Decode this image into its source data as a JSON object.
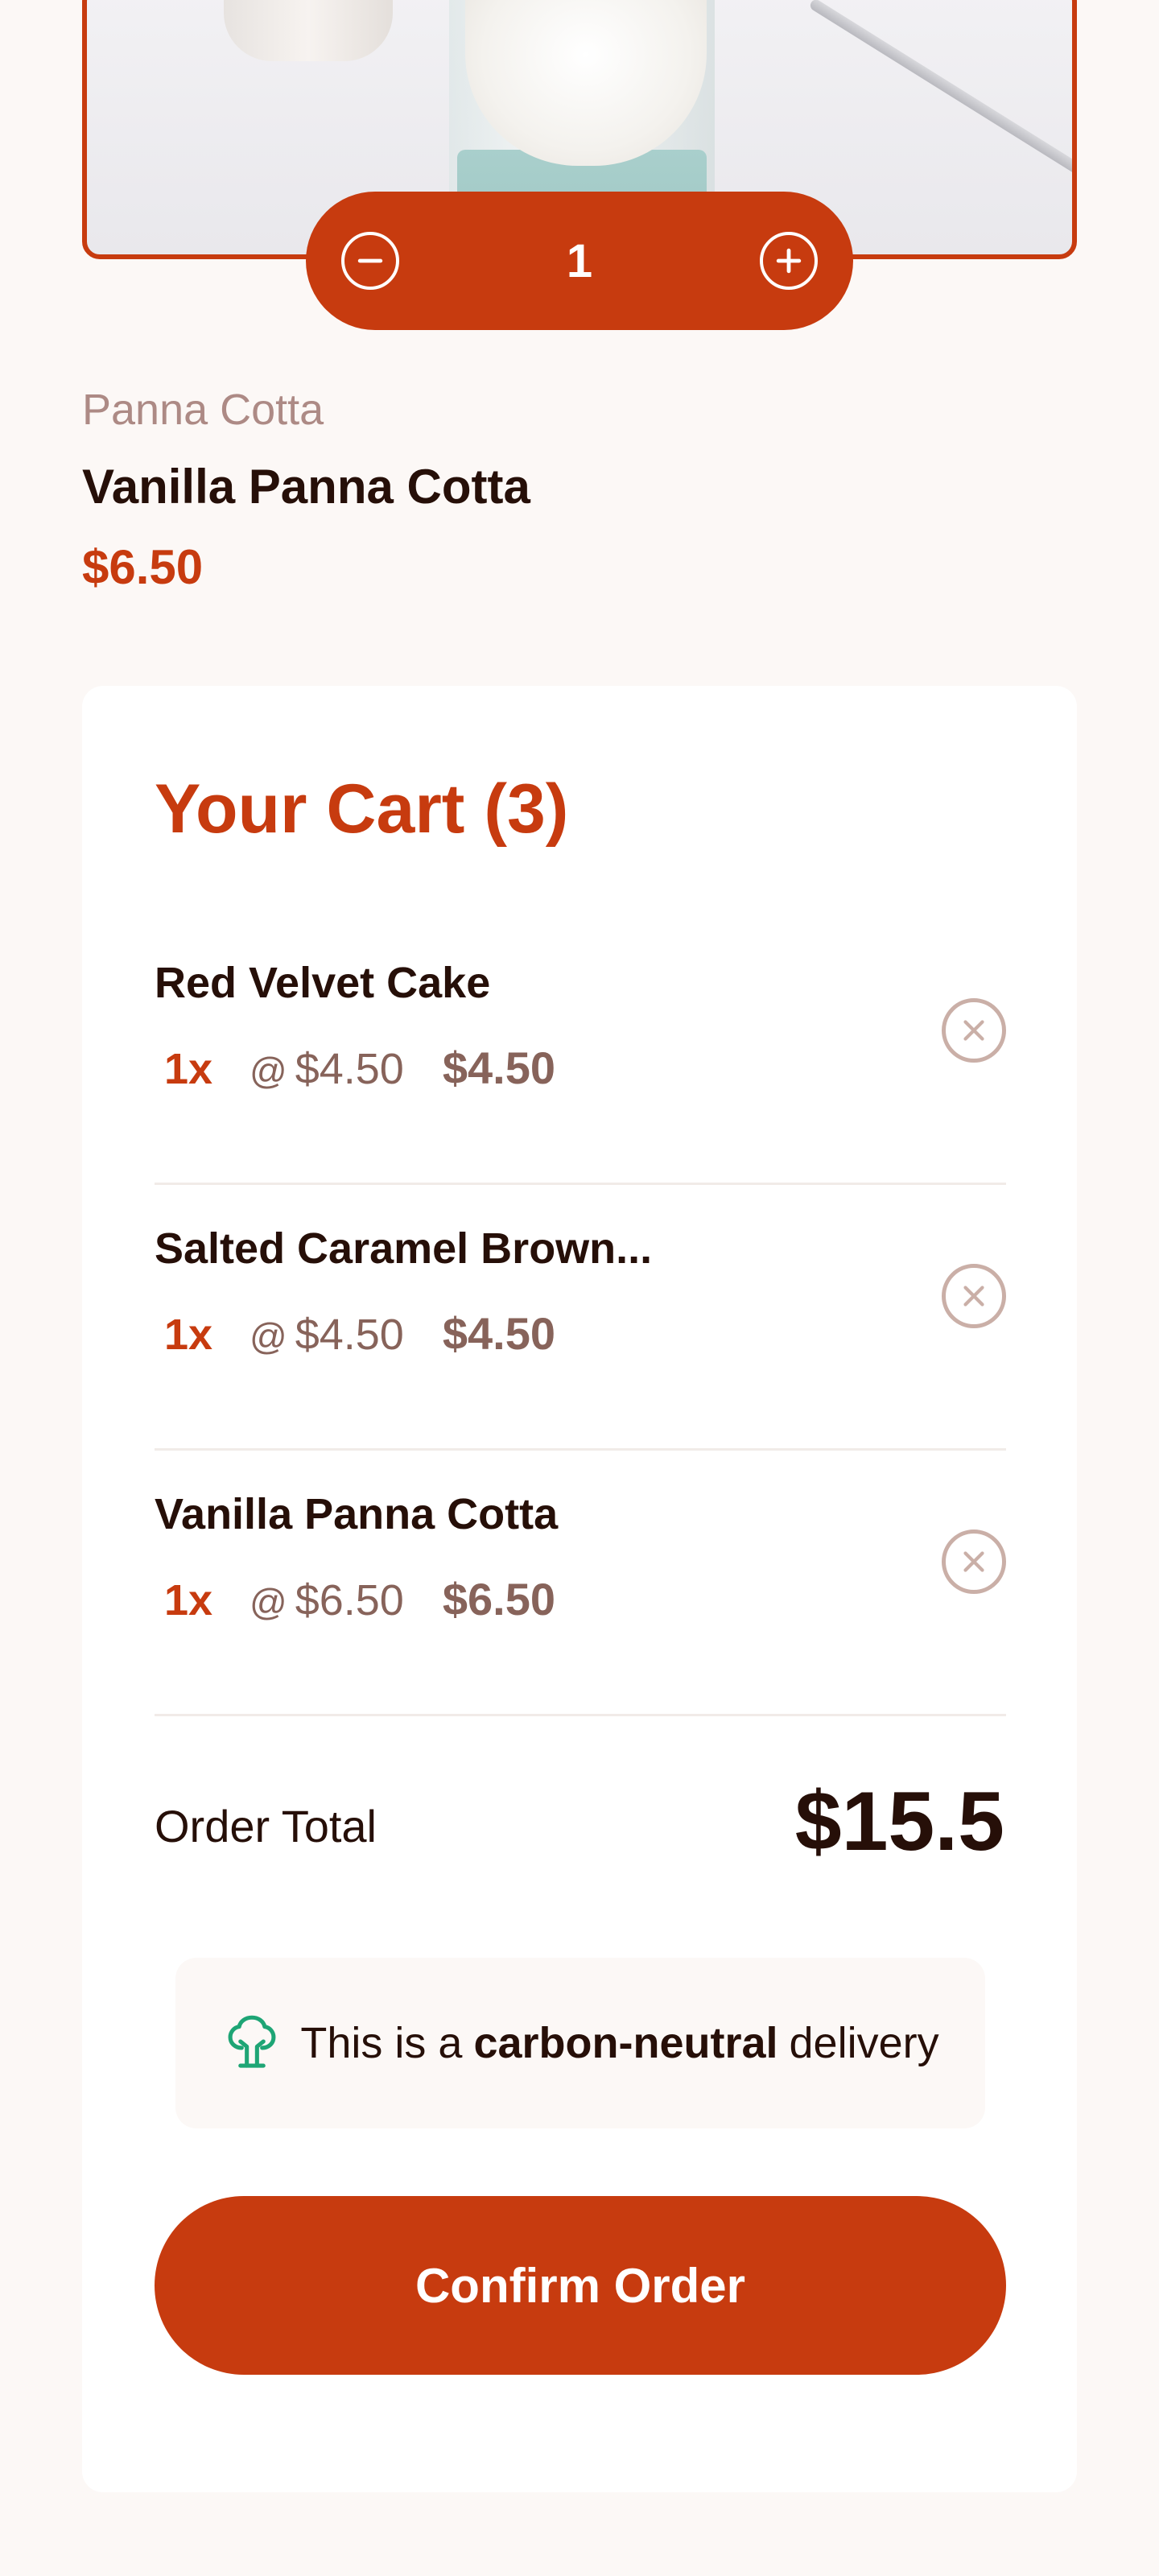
{
  "product": {
    "category": "Panna Cotta",
    "name": "Vanilla Panna Cotta",
    "price": "$6.50",
    "quantity": "1"
  },
  "cart": {
    "title": "Your Cart (3)",
    "items": [
      {
        "name": "Red Velvet Cake",
        "qty": "1x",
        "at": "@",
        "unit_price": "$4.50",
        "total": "$4.50"
      },
      {
        "name": "Salted Caramel Brown...",
        "qty": "1x",
        "at": "@",
        "unit_price": "$4.50",
        "total": "$4.50"
      },
      {
        "name": "Vanilla Panna Cotta",
        "qty": "1x",
        "at": "@",
        "unit_price": "$6.50",
        "total": "$6.50"
      }
    ],
    "order_total_label": "Order Total",
    "order_total_value": "$15.5",
    "carbon_prefix": "This is a",
    "carbon_bold": "carbon-neutral",
    "carbon_suffix": "delivery",
    "confirm_label": "Confirm Order"
  },
  "icons": {
    "decrement": "minus-circle-icon",
    "increment": "plus-circle-icon",
    "remove": "x-circle-icon",
    "carbon": "tree-icon"
  },
  "colors": {
    "accent": "#c73b0f",
    "text": "#260f08",
    "muted": "#87635a",
    "background": "#fcf8f6",
    "eco": "#1ea575"
  }
}
